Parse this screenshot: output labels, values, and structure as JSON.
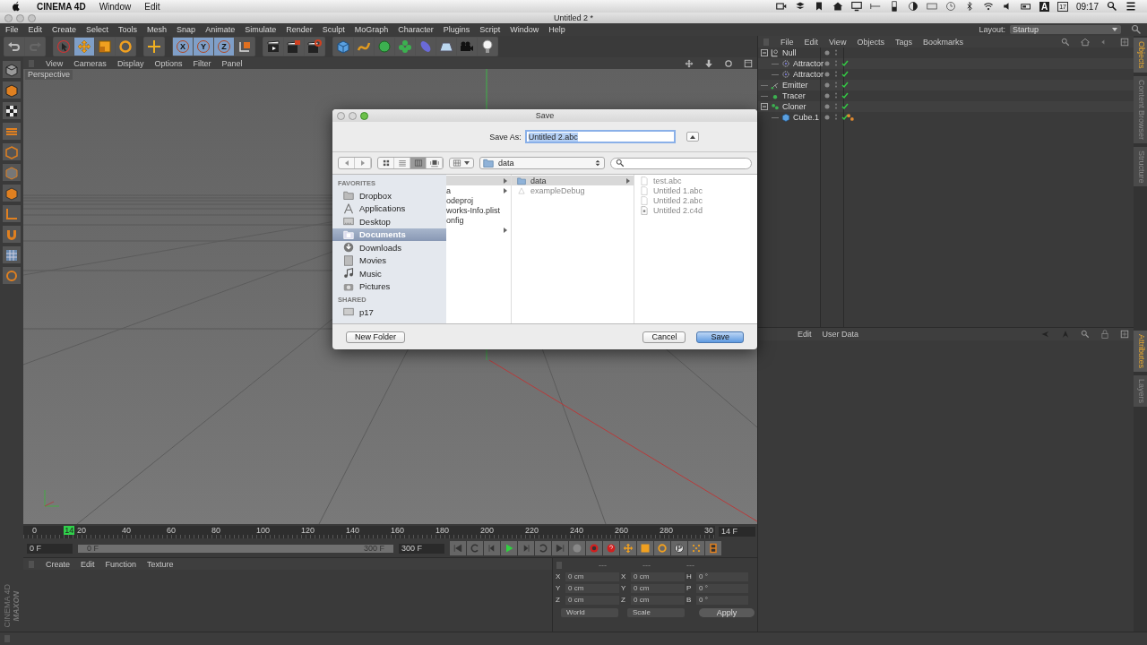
{
  "menubar": {
    "app": "CINEMA 4D",
    "menus": [
      "Window",
      "Edit"
    ],
    "input_source": "A",
    "calendar_day": "17",
    "clock": "09:17"
  },
  "window": {
    "title": "Untitled 2 *"
  },
  "menus": [
    "File",
    "Edit",
    "Create",
    "Select",
    "Tools",
    "Mesh",
    "Snap",
    "Animate",
    "Simulate",
    "Render",
    "Sculpt",
    "MoGraph",
    "Character",
    "Plugins",
    "Script",
    "Window",
    "Help"
  ],
  "layout": {
    "label": "Layout:",
    "value": "Startup"
  },
  "toolbar": [
    [
      {
        "kind": "undo",
        "selected": false
      },
      {
        "kind": "redo",
        "selected": false
      }
    ],
    [
      {
        "kind": "select",
        "selected": false
      },
      {
        "kind": "move",
        "selected": true
      },
      {
        "kind": "scale",
        "selected": false
      },
      {
        "kind": "rotate",
        "selected": false
      }
    ],
    [
      {
        "kind": "add",
        "selected": false
      }
    ],
    [
      {
        "kind": "axis",
        "label": "X",
        "selected": true
      },
      {
        "kind": "axis",
        "label": "Y",
        "selected": true
      },
      {
        "kind": "axis",
        "label": "Z",
        "selected": true
      },
      {
        "kind": "coord",
        "selected": false
      }
    ],
    [
      {
        "kind": "clapper",
        "selected": false
      },
      {
        "kind": "clapper-edit",
        "selected": false
      },
      {
        "kind": "clapper-gear",
        "selected": false
      }
    ],
    [
      {
        "kind": "cube",
        "selected": false
      },
      {
        "kind": "spline",
        "selected": false
      },
      {
        "kind": "nurbs",
        "selected": false
      },
      {
        "kind": "array",
        "selected": false
      },
      {
        "kind": "deformer",
        "selected": false
      },
      {
        "kind": "floor",
        "selected": false
      },
      {
        "kind": "camera",
        "selected": false
      },
      {
        "kind": "light",
        "selected": false
      }
    ]
  ],
  "viewport": {
    "menus": [
      "View",
      "Cameras",
      "Display",
      "Options",
      "Filter",
      "Panel"
    ],
    "camera": "Perspective"
  },
  "timeline": {
    "ticks": [
      "0",
      "20",
      "40",
      "60",
      "80",
      "100",
      "120",
      "140",
      "160",
      "180",
      "200",
      "220",
      "240",
      "260",
      "280",
      "30"
    ],
    "playhead": {
      "label": "14",
      "level": 0.047
    },
    "frame_field": "14 F",
    "start_field": "0 F",
    "range": {
      "start": "0 F",
      "end": "300 F",
      "level": 1
    },
    "end_field": "300 F"
  },
  "material_manager": {
    "menus": [
      "Create",
      "Edit",
      "Function",
      "Texture"
    ]
  },
  "coordinates": {
    "headers": [
      "---",
      "---",
      "---"
    ],
    "rows": [
      {
        "axis": "X",
        "position": "0 cm",
        "size_axis": "X",
        "size": "0 cm",
        "rot_axis": "H",
        "rotation": "0 °"
      },
      {
        "axis": "Y",
        "position": "0 cm",
        "size_axis": "Y",
        "size": "0 cm",
        "rot_axis": "P",
        "rotation": "0 °"
      },
      {
        "axis": "Z",
        "position": "0 cm",
        "size_axis": "Z",
        "size": "0 cm",
        "rot_axis": "B",
        "rotation": "0 °"
      }
    ],
    "mode": "World",
    "size_mode": "Scale",
    "apply": "Apply"
  },
  "object_manager": {
    "menus": [
      "File",
      "Edit",
      "View",
      "Objects",
      "Tags",
      "Bookmarks"
    ],
    "objects": [
      {
        "name": "Null",
        "kind": "null",
        "expanded": true,
        "tagged": false,
        "children": [
          {
            "name": "Attractor",
            "kind": "attractor",
            "checked": true,
            "tagged": false
          },
          {
            "name": "Attractor",
            "kind": "attractor",
            "checked": true,
            "tagged": false
          }
        ]
      },
      {
        "name": "Emitter",
        "kind": "emitter",
        "checked": true,
        "tagged": false
      },
      {
        "name": "Tracer",
        "kind": "tracer",
        "checked": true,
        "tagged": false
      },
      {
        "name": "Cloner",
        "kind": "cloner",
        "checked": true,
        "expanded": true,
        "tagged": false,
        "children": [
          {
            "name": "Cube.1",
            "kind": "cube",
            "checked": true,
            "tagged": true
          }
        ]
      }
    ]
  },
  "attribute_manager": {
    "menus": [
      "Edit",
      "User Data"
    ]
  },
  "side_tabs": [
    {
      "label": "Objects",
      "selected": true
    },
    {
      "label": "Content Browser",
      "selected": false
    },
    {
      "label": "Structure",
      "selected": false
    }
  ],
  "side_tabs_lower": [
    {
      "label": "Attributes",
      "selected": true
    },
    {
      "label": "Layers",
      "selected": false
    }
  ],
  "logo": {
    "brand": "MAXON",
    "product": "CINEMA 4D"
  },
  "dialog": {
    "title": "Save",
    "save_as_label": "Save As:",
    "filename": "Untitled 2.abc",
    "view_modes": [
      {
        "kind": "icons",
        "selected": false
      },
      {
        "kind": "list",
        "selected": false
      },
      {
        "kind": "columns",
        "selected": true
      },
      {
        "kind": "coverflow",
        "selected": false
      }
    ],
    "location": "data",
    "sidebar": [
      {
        "heading": "FAVORITES",
        "items": [
          {
            "label": "Dropbox",
            "kind": "folder",
            "selected": false
          },
          {
            "label": "Applications",
            "kind": "apps",
            "selected": false
          },
          {
            "label": "Desktop",
            "kind": "desktop",
            "selected": false
          },
          {
            "label": "Documents",
            "kind": "documents",
            "selected": true
          },
          {
            "label": "Downloads",
            "kind": "downloads",
            "selected": false
          },
          {
            "label": "Movies",
            "kind": "movies",
            "selected": false
          },
          {
            "label": "Music",
            "kind": "music",
            "selected": false
          },
          {
            "label": "Pictures",
            "kind": "pictures",
            "selected": false
          }
        ]
      },
      {
        "heading": "SHARED",
        "items": [
          {
            "label": "p17",
            "kind": "computer",
            "selected": false
          }
        ]
      }
    ],
    "columns": [
      [
        {
          "has_children": true,
          "selected": true,
          "disabled": false
        },
        {
          "label": "a",
          "has_children": true,
          "selected": false,
          "disabled": false
        },
        {
          "label": "odeproj",
          "has_children": false,
          "selected": false,
          "disabled": false
        },
        {
          "label": "works-Info.plist",
          "has_children": false,
          "selected": false,
          "disabled": false
        },
        {
          "label": "onfig",
          "has_children": false,
          "selected": false,
          "disabled": false
        },
        {
          "has_children": true,
          "selected": false,
          "disabled": false
        }
      ],
      [
        {
          "label": "data",
          "kind": "folder",
          "has_children": true,
          "selected": true,
          "disabled": false
        },
        {
          "label": "exampleDebug",
          "kind": "app",
          "has_children": false,
          "selected": false,
          "disabled": true
        }
      ],
      [
        {
          "label": "test.abc",
          "kind": "file",
          "has_children": false,
          "selected": false,
          "disabled": true
        },
        {
          "label": "Untitled 1.abc",
          "kind": "file",
          "has_children": false,
          "selected": false,
          "disabled": true
        },
        {
          "label": "Untitled 2.abc",
          "kind": "file",
          "has_children": false,
          "selected": false,
          "disabled": true
        },
        {
          "label": "Untitled 2.c4d",
          "kind": "c4d-file",
          "has_children": false,
          "selected": false,
          "disabled": true
        }
      ]
    ],
    "buttons": [
      {
        "label": "New Folder",
        "default": false
      },
      {
        "label": "Cancel",
        "default": false
      },
      {
        "label": "Save",
        "default": true
      }
    ]
  }
}
